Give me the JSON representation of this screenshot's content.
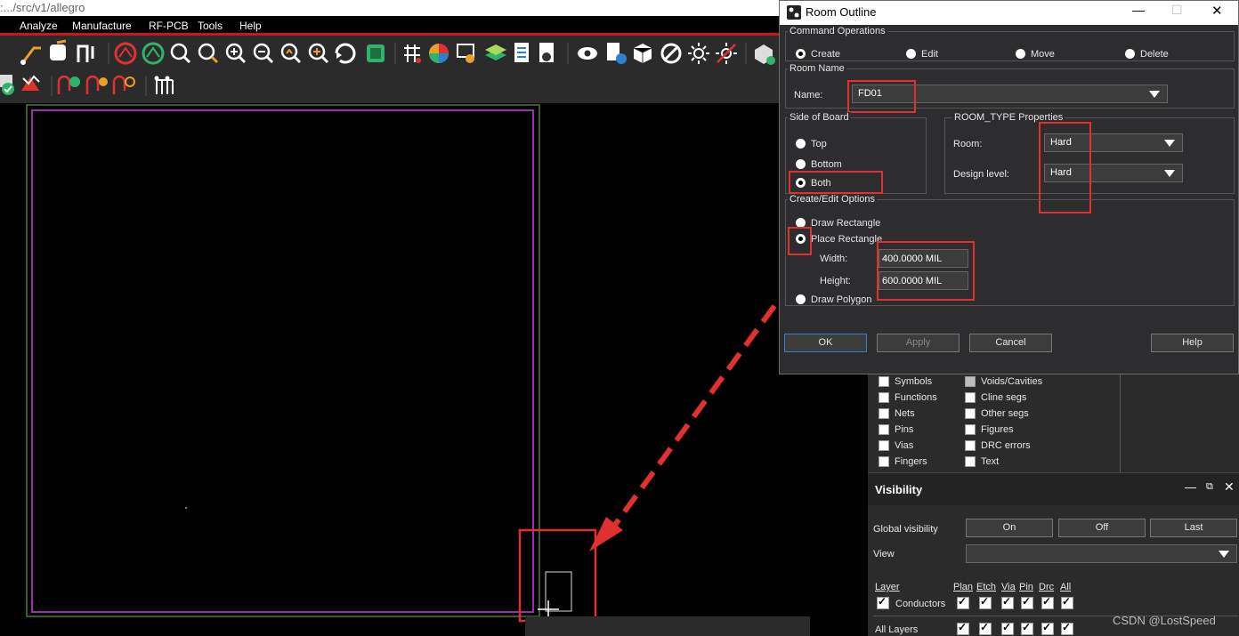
{
  "window": {
    "path": ":.../src/v1/allegro"
  },
  "menu": [
    "Analyze",
    "Manufacture",
    "RF-PCB",
    "Tools",
    "Help"
  ],
  "dialog": {
    "title": "Room Outline",
    "command_ops": {
      "title": "Command Operations",
      "options": [
        "Create",
        "Edit",
        "Move",
        "Delete"
      ],
      "selected": "Create"
    },
    "room_name": {
      "title": "Room Name",
      "label": "Name:",
      "value": "FD01"
    },
    "side_of_board": {
      "title": "Side of Board",
      "options": [
        "Top",
        "Bottom",
        "Both"
      ],
      "selected": "Both"
    },
    "room_type": {
      "title": "ROOM_TYPE Properties",
      "room_label": "Room:",
      "room_value": "Hard",
      "design_label": "Design level:",
      "design_value": "Hard"
    },
    "create_edit": {
      "title": "Create/Edit Options",
      "options": [
        "Draw Rectangle",
        "Place Rectangle",
        "Draw Polygon"
      ],
      "selected": "Place Rectangle",
      "width_label": "Width:",
      "width_value": "400.0000 MIL",
      "height_label": "Height:",
      "height_value": "600.0000 MIL"
    },
    "buttons": {
      "ok": "OK",
      "apply": "Apply",
      "cancel": "Cancel",
      "help": "Help"
    }
  },
  "find": {
    "left": [
      "Symbols",
      "Functions",
      "Nets",
      "Pins",
      "Vias",
      "Fingers"
    ],
    "right": [
      "Voids/Cavities",
      "Cline segs",
      "Other segs",
      "Figures",
      "DRC errors",
      "Text"
    ]
  },
  "visibility": {
    "title": "Visibility",
    "global_label": "Global visibility",
    "on": "On",
    "off": "Off",
    "last": "Last",
    "view_label": "View",
    "layer_header": "Layer",
    "columns": [
      "Plan",
      "Etch",
      "Via",
      "Pin",
      "Drc",
      "All"
    ],
    "rows": [
      "Conductors",
      "All Layers"
    ]
  },
  "watermark": "CSDN @LostSpeed",
  "colors": {
    "accent_red": "#e03030",
    "menu_border": "#c8161d",
    "room_outline": "#9a2fb0",
    "board_outline": "#4d7a3a"
  }
}
